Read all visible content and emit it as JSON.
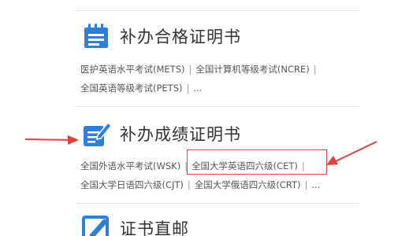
{
  "sections": [
    {
      "title": "补办合格证明书",
      "icon": "clipboard-list-icon",
      "links_line1": [
        "医护英语水平考试(METS)",
        "全国计算机等级考试(NCRE)"
      ],
      "links_line2": [
        "全国英语等级考试(PETS)",
        "..."
      ]
    },
    {
      "title": "补办成绩证明书",
      "icon": "document-edit-icon",
      "links_line1": [
        "全国外语水平考试(WSK)",
        "全国大学英语四六级(CET)"
      ],
      "links_line2": [
        "全国大学日语四六级(CJT)",
        "全国大学俄语四六级(CRT)",
        "..."
      ]
    },
    {
      "title": "证书直邮",
      "icon": "pencil-box-icon"
    }
  ],
  "colors": {
    "icon_blue": "#2f7fd8",
    "annotation_red": "#e04040"
  }
}
